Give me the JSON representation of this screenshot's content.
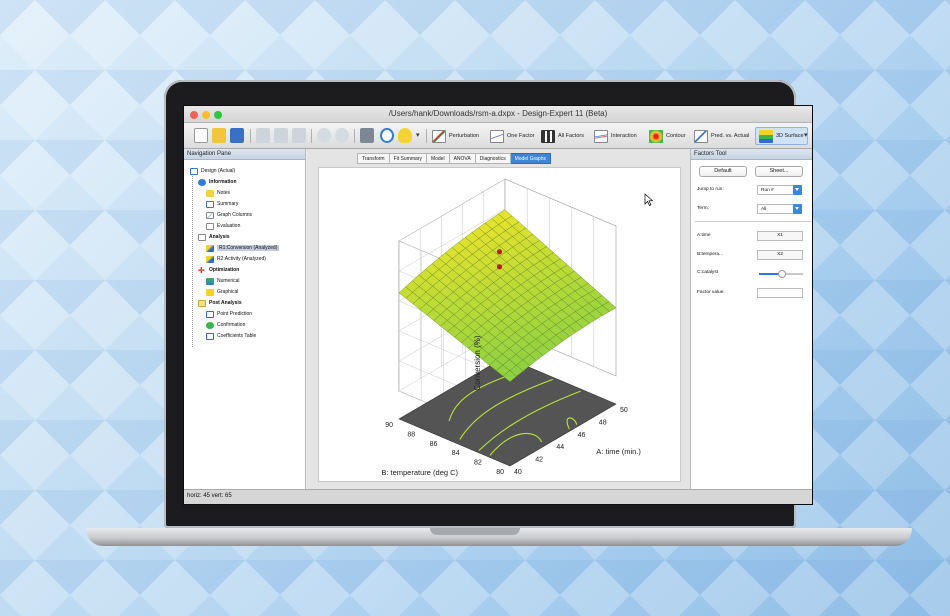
{
  "window": {
    "title": "/Users/hank/Downloads/rsm-a.dxpx - Design-Expert 11 (Beta)"
  },
  "toolbar": {
    "buttons": [
      "Perturbation",
      "One Factor",
      "All Factors",
      "Interaction",
      "Contour",
      "Pred. vs. Actual",
      "3D Surface"
    ]
  },
  "nav": {
    "header": "Navigation Pane",
    "items": {
      "design": "Design (Actual)",
      "information": "Information",
      "notes": "Notes",
      "summary": "Summary",
      "graph_columns": "Graph Columns",
      "evaluation": "Evaluation",
      "analysis": "Analysis",
      "r1": "R1:Conversion (Analyzed)",
      "r2": "R2:Activity (Analyzed)",
      "optimization": "Optimization",
      "numerical": "Numerical",
      "graphical": "Graphical",
      "post_analysis": "Post Analysis",
      "point_prediction": "Point Prediction",
      "confirmation": "Confirmation",
      "coefficients_table": "Coefficients Table"
    }
  },
  "tabs": [
    "Transform",
    "Fit Summary",
    "Model",
    "ANOVA",
    "Diagnostics",
    "Model Graphs"
  ],
  "active_tab": "Model Graphs",
  "factors": {
    "header": "Factors Tool",
    "default_btn": "Default",
    "sheet_btn": "Sheet...",
    "jump_label": "Jump to run:",
    "jump_value": "Run #",
    "term_label": "Term:",
    "term_value": "All",
    "a_label": "A:time",
    "a_axis": "X1",
    "b_label": "B:tempera...",
    "b_axis": "X2",
    "c_label": "C:catalyst",
    "factor_value_label": "Factor value:"
  },
  "status": {
    "text": "horiz: 45  vert: 65"
  },
  "chart_data": {
    "type": "surface3d",
    "zlabel": "Conversion (%)",
    "xlabel": "A: time (min.)",
    "ylabel": "B: temperature (deg C)",
    "z_ticks": [
      "100.0",
      "90.0",
      "80.0",
      "70.0",
      "60.0",
      "50.0"
    ],
    "a_ticks": [
      "40",
      "42",
      "44",
      "46",
      "48",
      "50"
    ],
    "b_ticks": [
      "80",
      "82",
      "84",
      "86",
      "88",
      "90"
    ],
    "zlim": [
      50,
      100
    ],
    "design_points_z": [
      91,
      86
    ],
    "colors": {
      "surface_low": "#8fd142",
      "surface_high": "#f1e52a",
      "contour_floor": "#545454",
      "contour_line": "#b8e33a",
      "point": "#b5201b"
    }
  }
}
